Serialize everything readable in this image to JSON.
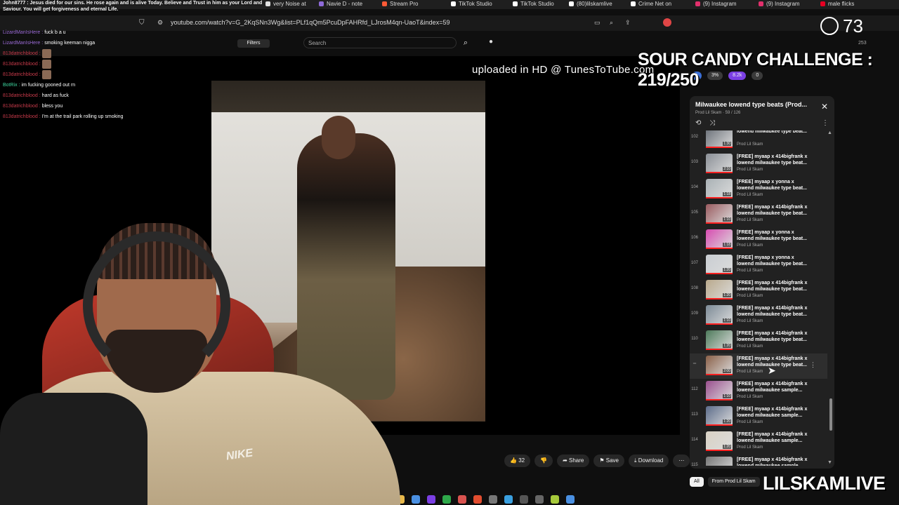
{
  "browser": {
    "tabs": [
      {
        "label": "very Noise at",
        "color": "#e0e0e0"
      },
      {
        "label": "Navie D - note",
        "color": "#8e6ad8"
      },
      {
        "label": "Stream Pro",
        "color": "#ff5a36"
      },
      {
        "label": "TikTok Studio",
        "color": "#ffffff"
      },
      {
        "label": "TikTok Studio",
        "color": "#ffffff"
      },
      {
        "label": "(80)lilskamlive",
        "color": "#ffffff"
      },
      {
        "label": "Crime Net on",
        "color": "#ffffff"
      },
      {
        "label": "(9) Instagram",
        "color": "#e1306c"
      },
      {
        "label": "(9) Instagram",
        "color": "#e1306c"
      },
      {
        "label": "male flicks",
        "color": "#e60023"
      }
    ],
    "url": "youtube.com/watch?v=G_2KqSNn3Wg&list=PLf1qQm5PcuDpFAHRfd_LJrosM4qn-UaoT&index=59"
  },
  "chat_header": "John8777 : Jesus died for our sins. He rose again and is alive Today. Believe and Trust in him as your Lord and Saviour. You will get forgiveness and eternal Life.",
  "chat": [
    {
      "user": "LizardManIsHere",
      "msg": "fuck b a u",
      "style": "g",
      "emote": false
    },
    {
      "user": "LizardManIsHere",
      "msg": "smoking keeman nigga",
      "style": "g",
      "emote": false
    },
    {
      "user": "813datrichblood",
      "msg": "",
      "style": "r",
      "emote": true
    },
    {
      "user": "813datrichblood",
      "msg": "",
      "style": "r",
      "emote": true
    },
    {
      "user": "813datrichblood",
      "msg": "",
      "style": "r",
      "emote": true
    },
    {
      "user": "BotRix",
      "msg": "im fucking gooned out rn",
      "style": "b",
      "emote": false
    },
    {
      "user": "813datrichblood",
      "msg": "hard as fuck",
      "style": "r",
      "emote": false
    },
    {
      "user": "813datrichblood",
      "msg": "bless you",
      "style": "r",
      "emote": false
    },
    {
      "user": "813datrichblood",
      "msg": "I'm at the trail park rolling up smoking",
      "style": "r",
      "emote": false
    }
  ],
  "youtube": {
    "filters_label": "Filters",
    "search_placeholder": "Search",
    "watermark": "uploaded in HD @ TunesToTube.com",
    "actions": {
      "likes": "32",
      "share": "Share",
      "save": "Save",
      "download": "Download"
    },
    "chips": [
      "All",
      "From Prod Lil Skam"
    ]
  },
  "overlay": {
    "challenge": "SOUR CANDY CHALLENGE : 219/250",
    "viewers": "73",
    "brand": "LILSKAMLIVE",
    "nike": "NIKE",
    "top_right": "253",
    "badges": [
      "3%",
      "8.2k",
      "0"
    ]
  },
  "playlist": {
    "title": "Milwaukee lowend type beats (Prod...",
    "subtitle": "Prod Lil Skam · 59 / 126",
    "items": [
      {
        "idx": "102",
        "title": "lowend milwaukee type beat...",
        "channel": "Prod Lil Skam",
        "dur": "1:30"
      },
      {
        "idx": "103",
        "title": "[FREE] myaap x 414bigfrank x lowend milwaukee type beat...",
        "channel": "Prod Lil Skam",
        "dur": "2:10"
      },
      {
        "idx": "104",
        "title": "[FREE] myaap x yonna x lowend milwaukee type beat...",
        "channel": "Prod Lil Skam",
        "dur": "1:18"
      },
      {
        "idx": "105",
        "title": "[FREE] myaap x 414bigfrank x lowend milwaukee type beat...",
        "channel": "Prod Lil Skam",
        "dur": "1:10"
      },
      {
        "idx": "106",
        "title": "[FREE] myaap x yonna x lowend milwaukee type beat...",
        "channel": "Prod Lil Skam",
        "dur": "1:18"
      },
      {
        "idx": "107",
        "title": "[FREE] myaap x yonna x lowend milwaukee type beat...",
        "channel": "Prod Lil Skam",
        "dur": "1:20"
      },
      {
        "idx": "108",
        "title": "[FREE] myaap x 414bigfrank x lowend milwaukee type beat...",
        "channel": "Prod Lil Skam",
        "dur": "1:20"
      },
      {
        "idx": "109",
        "title": "[FREE] myaap x 414bigfrank x lowend milwaukee type beat...",
        "channel": "Prod Lil Skam",
        "dur": "1:10"
      },
      {
        "idx": "110",
        "title": "[FREE] myaap x 414bigfrank x lowend milwaukee type beat...",
        "channel": "Prod Lil Skam",
        "dur": "1:20"
      },
      {
        "idx": "",
        "title": "[FREE] myaap x 414bigfrank x lowend milwaukee type beat...",
        "channel": "Prod Lil Skam",
        "dur": "2:00"
      },
      {
        "idx": "112",
        "title": "[FREE] myaap x 414bigfrank x lowend milwaukee sample...",
        "channel": "Prod Lil Skam",
        "dur": "1:10"
      },
      {
        "idx": "113",
        "title": "[FREE] myaap x 414bigfrank x lowend milwaukee sample...",
        "channel": "Prod Lil Skam",
        "dur": "1:20"
      },
      {
        "idx": "114",
        "title": "[FREE] myaap x 414bigfrank x lowend milwaukee sample...",
        "channel": "Prod Lil Skam",
        "dur": "1:20"
      },
      {
        "idx": "115",
        "title": "[FREE] myaap x 414bigfrank x lowend milwaukee sample...",
        "channel": "Prod Lil Skam",
        "dur": "1:20"
      }
    ],
    "active_index": 9
  }
}
